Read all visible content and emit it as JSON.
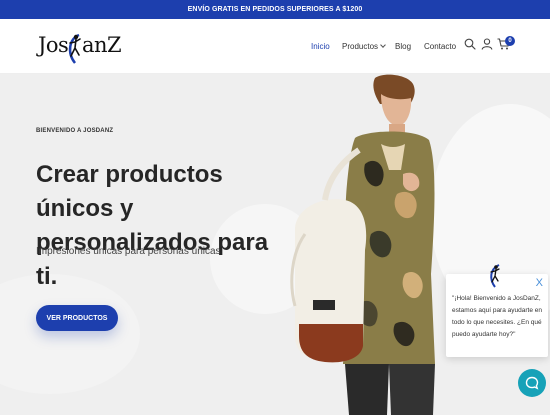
{
  "topbar": {
    "text": "ENVÍO GRATIS EN PEDIDOS SUPERIORES A $1200"
  },
  "logo": {
    "left": "Jos",
    "right": "anZ"
  },
  "nav": {
    "items": [
      {
        "label": "Inicio",
        "active": true
      },
      {
        "label": "Productos",
        "has_dropdown": true
      },
      {
        "label": "Blog"
      },
      {
        "label": "Contacto"
      }
    ]
  },
  "header_icons": [
    "search-icon",
    "user-icon",
    "cart-icon"
  ],
  "cart": {
    "count": "0"
  },
  "hero": {
    "eyebrow": "BIENVENIDO A JOSDANZ",
    "headline": "Crear productos únicos y personalizados para ti.",
    "subtitle": "Impresiones únicas para personas únicas",
    "cta_label": "VER PRODUCTOS"
  },
  "chat": {
    "message": "\"¡Hola! Bienvenido a JosDanZ, estamos aquí para ayudarte en todo lo que necesites. ¿En qué puedo ayudarte hoy?\"",
    "close": "X"
  },
  "colors": {
    "brand": "#1d3fae",
    "chat_fab": "#17a2b8",
    "hero_bg": "#efefef"
  }
}
